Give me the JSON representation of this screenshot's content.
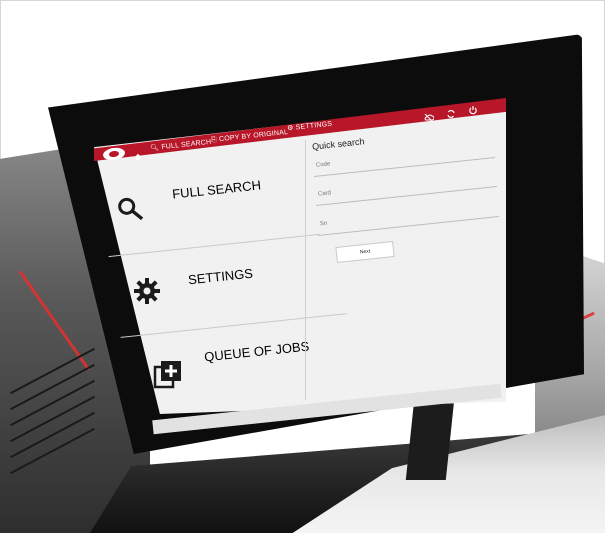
{
  "nav": {
    "full_search": "FULL SEARCH",
    "copy_by_original": "COPY BY ORIGINAL",
    "settings": "SETTINGS",
    "icons": [
      "logo",
      "home-icon",
      "search-icon",
      "copy-icon",
      "gear-icon",
      "cloud-icon",
      "sync-icon",
      "power-icon"
    ]
  },
  "menu": {
    "items": [
      {
        "label": "FULL SEARCH",
        "icon": "search-icon"
      },
      {
        "label": "SETTINGS",
        "icon": "gear-icon"
      },
      {
        "label": "QUEUE OF JOBS",
        "icon": "queue-add-icon"
      }
    ]
  },
  "quick_search": {
    "title": "Quick search",
    "fields": [
      {
        "label": "Code"
      },
      {
        "label": "Card"
      },
      {
        "label": "Sn"
      }
    ],
    "next_label": "Next"
  },
  "colors": {
    "brand_red": "#b8172a",
    "screen_bg": "#f1f1f1"
  }
}
